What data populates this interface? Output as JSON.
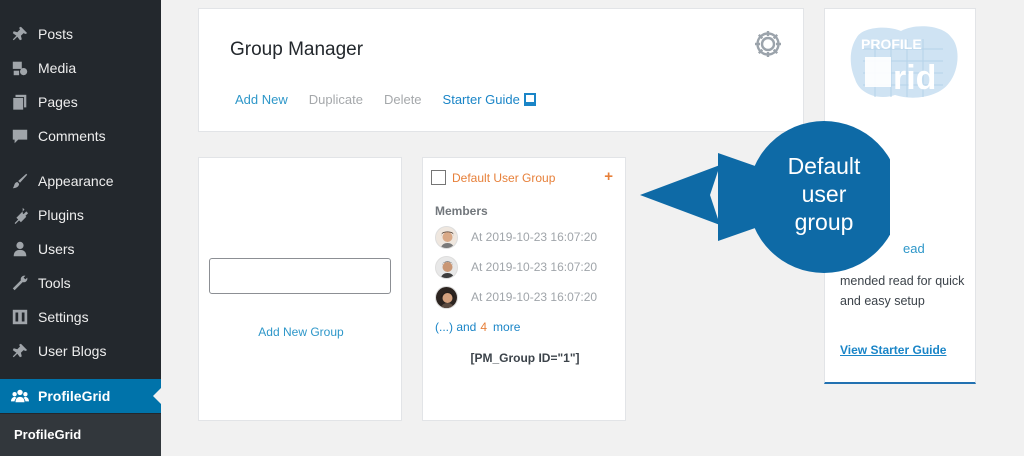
{
  "sidebar": {
    "items": [
      {
        "label": "Posts",
        "icon": "pin-icon"
      },
      {
        "label": "Media",
        "icon": "media-icon"
      },
      {
        "label": "Pages",
        "icon": "pages-icon"
      },
      {
        "label": "Comments",
        "icon": "comment-icon"
      },
      {
        "label": "Appearance",
        "icon": "brush-icon"
      },
      {
        "label": "Plugins",
        "icon": "plug-icon"
      },
      {
        "label": "Users",
        "icon": "user-icon"
      },
      {
        "label": "Tools",
        "icon": "wrench-icon"
      },
      {
        "label": "Settings",
        "icon": "settings-icon"
      },
      {
        "label": "User Blogs",
        "icon": "pin-icon"
      },
      {
        "label": "ProfileGrid",
        "icon": "group-icon",
        "active": true
      }
    ],
    "submenu_label": "ProfileGrid"
  },
  "header": {
    "title": "Group Manager",
    "actions": {
      "add_new": "Add New",
      "duplicate": "Duplicate",
      "delete": "Delete",
      "starter_guide": "Starter Guide"
    }
  },
  "add_group": {
    "input_value": "",
    "button_label": "Add New Group"
  },
  "group_card": {
    "title": "Default User Group",
    "plus": "+",
    "members_label": "Members",
    "members": [
      {
        "time": "At 2019-10-23 16:07:20"
      },
      {
        "time": "At 2019-10-23 16:07:20"
      },
      {
        "time": "At 2019-10-23 16:07:20"
      }
    ],
    "more_prefix": "(...) and",
    "more_count": "4",
    "more_suffix": "more",
    "shortcode": "[PM_Group ID=\"1\"]"
  },
  "right_panel": {
    "logo_top": "PROFILE",
    "logo_bottom": "rid",
    "read_heading": "ead",
    "recommend_text": "mended read for quick and easy setup",
    "view_guide": "View Starter Guide"
  },
  "callout": {
    "line1": "Default",
    "line2": "user",
    "line3": "group"
  },
  "colors": {
    "sidebar_bg": "#23282d",
    "active_bg": "#0073aa",
    "link": "#2e97c9",
    "accent_orange": "#e7803a",
    "callout_blue": "#0e6aa6"
  }
}
